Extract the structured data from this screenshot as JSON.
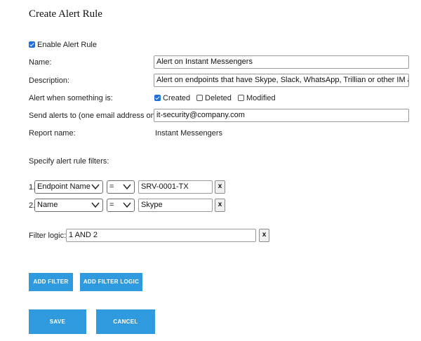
{
  "page": {
    "title": "Create Alert Rule"
  },
  "enable": {
    "label": "Enable Alert Rule",
    "checked": true
  },
  "name": {
    "label": "Name:",
    "value": "Alert on Instant Messengers"
  },
  "description": {
    "label": "Description:",
    "value": "Alert on endpoints that have Skype, Slack, WhatsApp, Trillian or other IM applicatio"
  },
  "alert_when": {
    "label": "Alert when something is:",
    "options": [
      {
        "label": "Created",
        "checked": true
      },
      {
        "label": "Deleted",
        "checked": false
      },
      {
        "label": "Modified",
        "checked": false
      }
    ]
  },
  "send_alerts": {
    "label": "Send alerts to (one email address only):",
    "value": "it-security@company.com"
  },
  "report_name": {
    "label": "Report name:",
    "value": "Instant Messengers"
  },
  "filters": {
    "heading": "Specify alert rule filters:",
    "rows": [
      {
        "index": "1.",
        "field": "Endpoint Name",
        "operator": "=",
        "value": "SRV-0001-TX",
        "remove": "x"
      },
      {
        "index": "2.",
        "field": "Name",
        "operator": "=",
        "value": "Skype",
        "remove": "x"
      }
    ]
  },
  "filter_logic": {
    "label": "Filter logic:",
    "value": "1 AND 2",
    "remove": "x"
  },
  "buttons": {
    "add_filter": "ADD FILTER",
    "add_filter_logic": "ADD FILTER LOGIC",
    "save": "SAVE",
    "cancel": "CANCEL"
  },
  "colors": {
    "accent": "#2f9bde",
    "checkbox": "#1d6fe0"
  }
}
